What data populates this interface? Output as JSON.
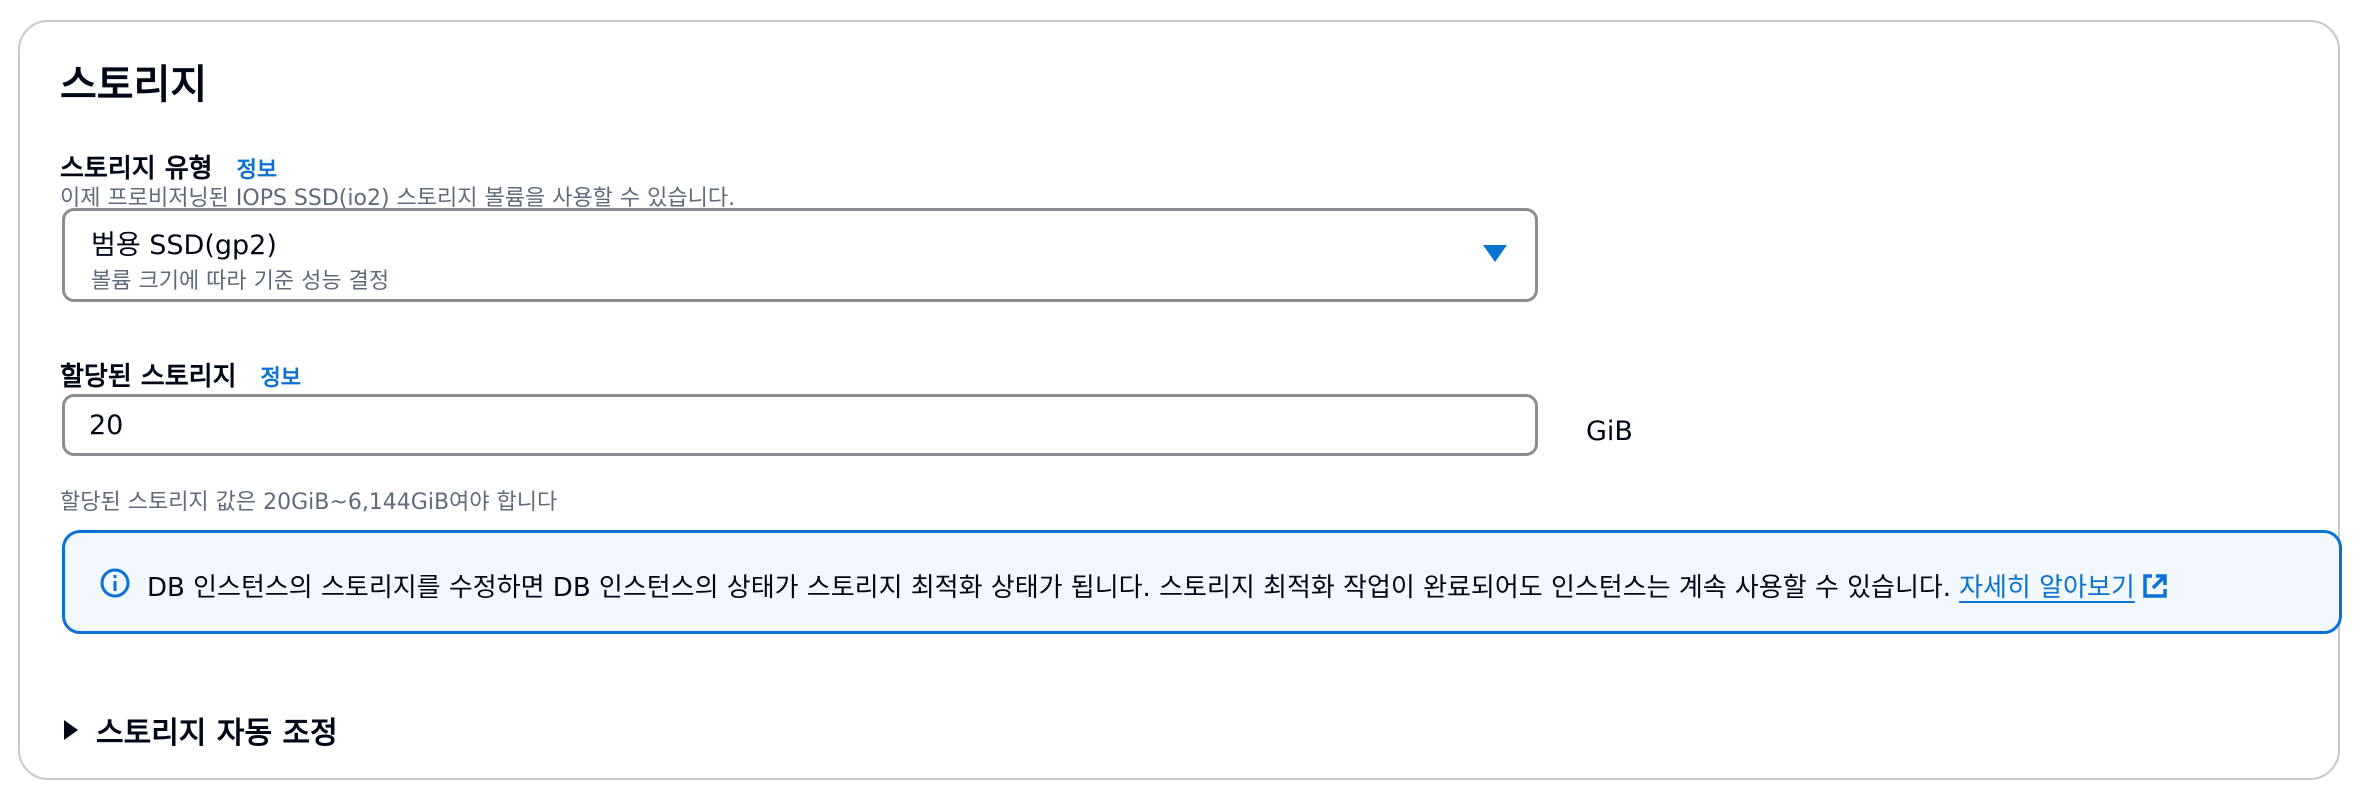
{
  "section": {
    "title": "스토리지"
  },
  "storage_type": {
    "label": "스토리지 유형",
    "info": "정보",
    "description": "이제 프로비저닝된 IOPS SSD(io2) 스토리지 볼륨을 사용할 수 있습니다.",
    "selected_value": "범용 SSD(gp2)",
    "selected_description": "볼륨 크기에 따라 기준 성능 결정"
  },
  "allocated_storage": {
    "label": "할당된 스토리지",
    "info": "정보",
    "value": "20",
    "unit": "GiB",
    "constraint": "할당된 스토리지 값은 20GiB~6,144GiB여야 합니다"
  },
  "alert": {
    "message": "DB 인스턴스의 스토리지를 수정하면 DB 인스턴스의 상태가 스토리지 최적화 상태가 됩니다. 스토리지 최적화 작업이 완료되어도 인스턴스는 계속 사용할 수 있습니다.",
    "link": "자세히 알아보기",
    "icon": "info-icon",
    "link_icon": "external-link-icon"
  },
  "autoscaling": {
    "label": "스토리지 자동 조정",
    "icon": "caret-right-icon"
  },
  "colors": {
    "accent": "#0972d3",
    "alert_background": "#f2f8fd",
    "border": "#8c8c94"
  }
}
